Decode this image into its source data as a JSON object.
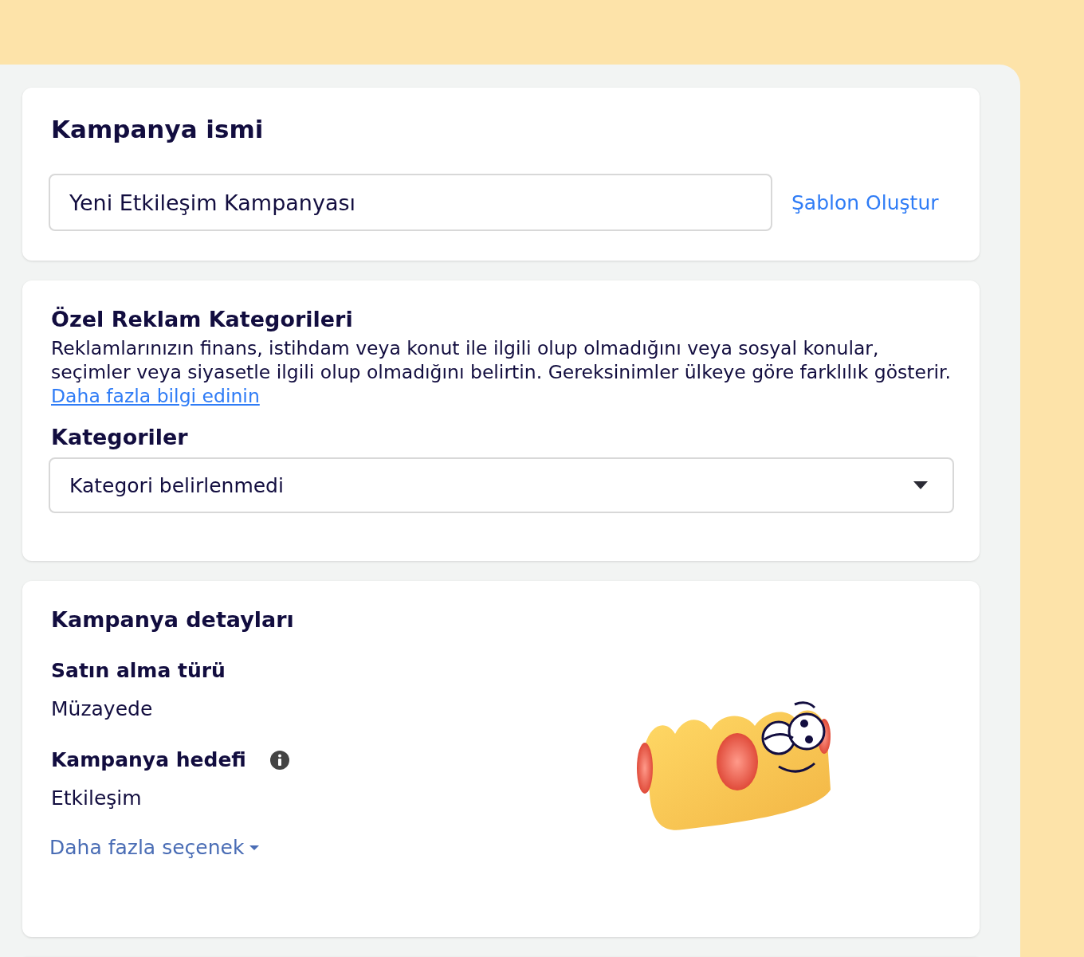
{
  "campaign_name": {
    "title": "Kampanya ismi",
    "field": {
      "value": "Yeni Etkileşim Kampanyası"
    },
    "template_link": "Şablon Oluştur"
  },
  "special_ad_categories": {
    "title": "Özel Reklam Kategorileri",
    "description": "Reklamlarınızın finans, istihdam veya konut ile ilgili olup olmadığını veya sosyal konular, seçimler veya siyasetle ilgili olup olmadığını belirtin. Gereksinimler ülkeye göre farklılık gösterir.",
    "learn_more_link": "Daha fazla bilgi edinin",
    "categories": {
      "label": "Kategoriler",
      "value": "Kategori belirlenmedi"
    }
  },
  "campaign_details": {
    "title": "Kampanya detayları",
    "fields": [
      {
        "label": "Satın alma türü",
        "value": "Müzayede",
        "info": false
      },
      {
        "label": "Kampanya hedefi",
        "value": "Etkileşim",
        "info": true
      }
    ],
    "more_options": "Daha fazla seçenek"
  }
}
